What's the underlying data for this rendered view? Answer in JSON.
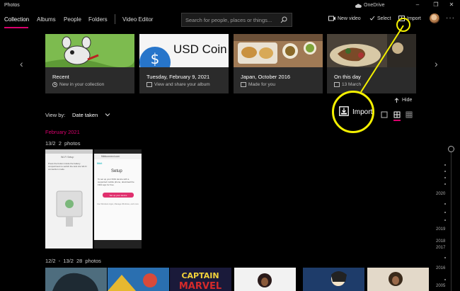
{
  "window": {
    "title": "Photos",
    "onedrive": "OneDrive"
  },
  "nav": {
    "tabs": [
      "Collection",
      "Albums",
      "People",
      "Folders",
      "Video Editor"
    ],
    "search_placeholder": "Search for people, places or things...",
    "new_video": "New video",
    "select": "Select",
    "import": "Import"
  },
  "cards": [
    {
      "title": "Recent",
      "subtitle": "New in your collection"
    },
    {
      "title": "Tuesday, February 9, 2021",
      "subtitle": "View and share your album",
      "image_text": "USD Coin"
    },
    {
      "title": "Japan, October 2016",
      "subtitle": "Made for you"
    },
    {
      "title": "On this day",
      "subtitle": "13 March"
    }
  ],
  "hide_label": "Hide",
  "view_by": {
    "label": "View by:",
    "value": "Date taken"
  },
  "callout": {
    "label": "Import"
  },
  "month_label": "February 2021",
  "groups": [
    {
      "date": "13/2",
      "count": "2 photos"
    },
    {
      "date": "12/2 - 13/2",
      "count": "28 photos"
    }
  ],
  "screenshot1": {
    "header": "Wi-Fi Setup",
    "body": "Press the button inside the battery compartment to switch the lock into Wi-Fi connection mode."
  },
  "screenshot2": {
    "url": "fitbitconnect.com",
    "brand": "fitbit",
    "heading": "Setup",
    "body": "To set up your Fitbit device with a supported mobile phone, download the Fitbit app for free.",
    "button": "Set up your device",
    "link": "Use Windows Apps, Manage Windows, and more"
  },
  "timeline": {
    "years": [
      "2020",
      "2019",
      "2018",
      "2017",
      "2016",
      "2005"
    ]
  },
  "colors": {
    "accent": "#d9006c",
    "callout": "#f4f000",
    "background": "#000000"
  }
}
